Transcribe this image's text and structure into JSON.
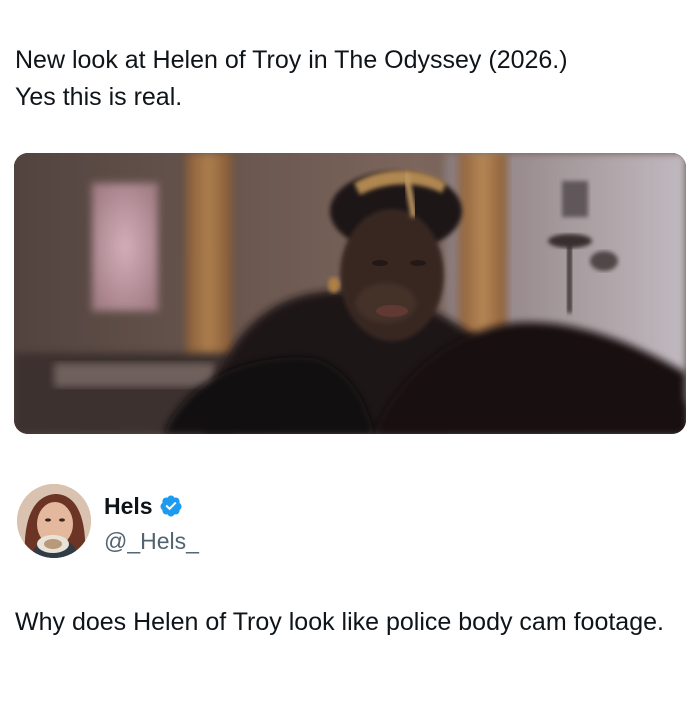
{
  "post": {
    "text": "New look at Helen of Troy in The Odyssey (2026.)\nYes this is real.",
    "media": {
      "kind": "video-still",
      "icon": "photo-of-woman-in-dim-room"
    }
  },
  "reply": {
    "author": {
      "display_name": "Hels",
      "handle": "@_Hels_",
      "verified": true,
      "verified_icon": "verified-badge-icon",
      "verified_color": "#1d9bf0"
    },
    "text": "Why does Helen of Troy look like police body cam footage."
  },
  "colors": {
    "text_primary": "#0f1419",
    "text_secondary": "#536471",
    "background": "#ffffff"
  }
}
